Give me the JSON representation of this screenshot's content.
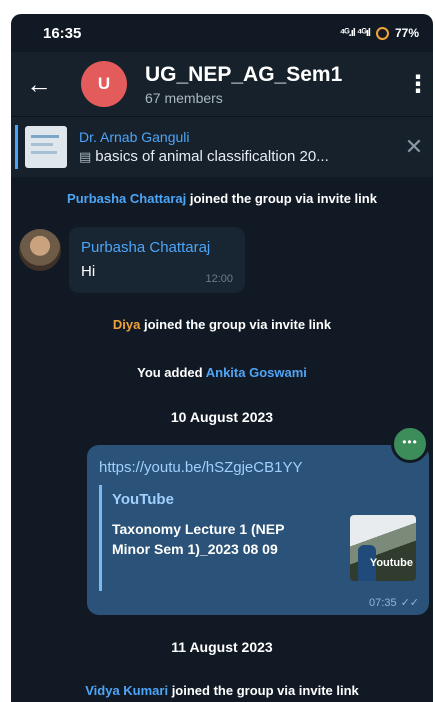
{
  "status": {
    "time": "16:35",
    "net": "⁴ᴳ.ıl ⁴ᴳıl",
    "battery": "77%"
  },
  "header": {
    "avatar_letter": "U",
    "title": "UG_NEP_AG_Sem1",
    "subtitle": "67 members"
  },
  "pinned": {
    "sender": "Dr. Arnab Ganguli",
    "doc": "basics of animal classificaltion 20..."
  },
  "chat": {
    "service1": {
      "name": "Purbasha Chattaraj",
      "rest": " joined the group via invite link"
    },
    "msg1": {
      "sender": "Purbasha Chattaraj",
      "text": "Hi",
      "time": "12:00"
    },
    "service2": {
      "name": "Diya",
      "rest": " joined the group via invite link"
    },
    "service3": {
      "lead": "You added ",
      "name": "Ankita Goswami"
    },
    "date1": "10 August 2023",
    "msg2": {
      "link": "https://youtu.be/hSZgjeCB1YY",
      "site": "YouTube",
      "title": "Taxonomy Lecture 1 (NEP Minor Sem 1)_2023 08 09",
      "thumb_label": "Youtube",
      "time": "07:35"
    },
    "date2": "11 August 2023",
    "service4": {
      "name": "Vidya Kumari",
      "rest": " joined the group via invite link"
    }
  },
  "colors": {
    "background": "#111a24",
    "header": "#17212b",
    "accent": "#4ea4f6",
    "outgoing": "#2b5278",
    "avatar": "#e45b5b"
  }
}
